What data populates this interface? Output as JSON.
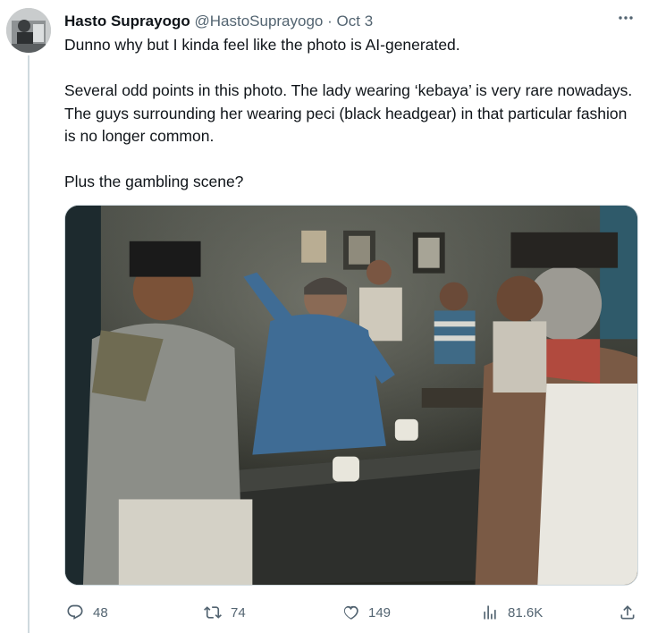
{
  "tweet": {
    "author_name": "Hasto Suprayogo",
    "author_handle": "@HastoSuprayogo",
    "separator": "·",
    "date": "Oct 3",
    "paragraphs": [
      "Dunno why but I kinda feel like the photo is AI-generated.",
      "Several odd points in this photo. The lady wearing ‘kebaya’ is very rare nowadays. The guys surrounding her wearing peci (black headgear) in that particular fashion is no longer common.",
      "Plus the gambling scene?"
    ]
  },
  "actions": {
    "replies": "48",
    "retweets": "74",
    "likes": "149",
    "views": "81.6K"
  },
  "icons": {
    "more": "more-icon",
    "reply": "reply-icon",
    "retweet": "retweet-icon",
    "like": "heart-icon",
    "views": "views-icon",
    "share": "share-icon"
  },
  "colors": {
    "text": "#0f1419",
    "muted": "#536471",
    "divider": "#cfd9de"
  }
}
